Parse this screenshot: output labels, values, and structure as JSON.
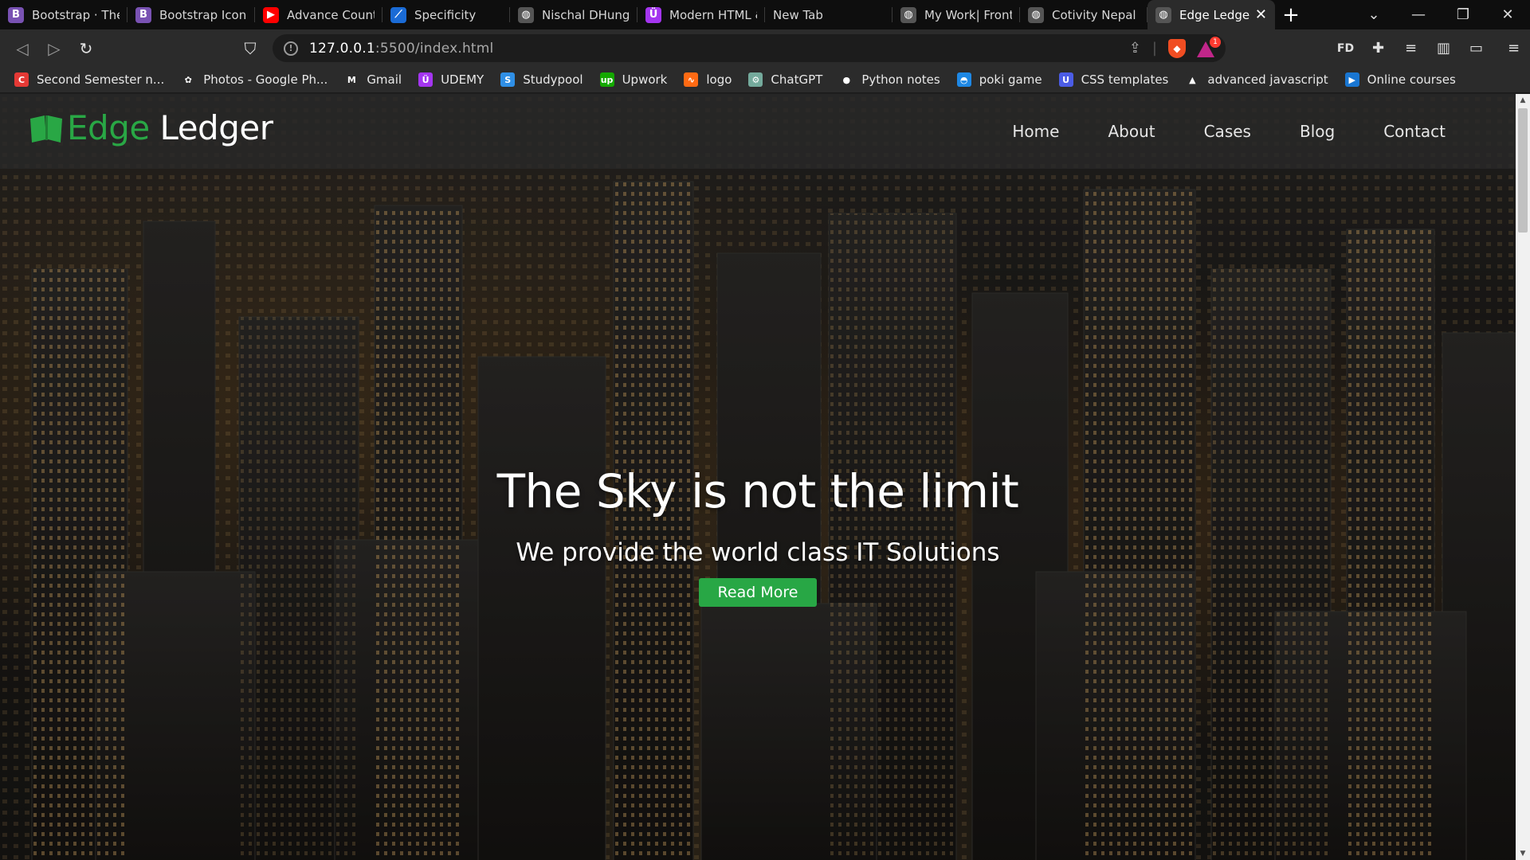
{
  "browser": {
    "tabs": [
      {
        "title": "Bootstrap · The m",
        "icon": "bootstrap-icon",
        "icon_bg": "#7952b3",
        "icon_text": "B"
      },
      {
        "title": "Bootstrap Icons",
        "icon": "bootstrap-icon",
        "icon_bg": "#7952b3",
        "icon_text": "B"
      },
      {
        "title": "Advance Countin",
        "icon": "youtube-icon",
        "icon_bg": "#ff0000",
        "icon_text": "▶"
      },
      {
        "title": "Specificity",
        "icon": "mdn-icon",
        "icon_bg": "#1a6bd6",
        "icon_text": "⟋"
      },
      {
        "title": "Nischal DHunge",
        "icon": "globe-icon",
        "icon_bg": "#555555",
        "icon_text": "◍"
      },
      {
        "title": "Modern HTML &",
        "icon": "udemy-icon",
        "icon_bg": "#a435f0",
        "icon_text": "Ü"
      },
      {
        "title": "New Tab",
        "icon": "",
        "icon_bg": "",
        "icon_text": ""
      },
      {
        "title": "My Work| Front E",
        "icon": "globe-icon",
        "icon_bg": "#555555",
        "icon_text": "◍"
      },
      {
        "title": "Cotivity Nepal Cl",
        "icon": "globe-icon",
        "icon_bg": "#555555",
        "icon_text": "◍"
      },
      {
        "title": "Edge Ledger",
        "icon": "globe-icon",
        "icon_bg": "#555555",
        "icon_text": "◍",
        "active": true
      }
    ],
    "new_tab_label": "+",
    "address": {
      "host": "127.0.0.1",
      "path": ":5500/index.html"
    },
    "extension_badge": "1",
    "profile_label": "FD",
    "bookmarks": [
      {
        "label": "Second Semester n...",
        "icon": "bookmark-c-icon",
        "icon_bg": "#e53935",
        "icon_text": "C"
      },
      {
        "label": "Photos - Google Ph...",
        "icon": "google-photos-icon",
        "icon_bg": "#2b2b2b",
        "icon_text": "✿"
      },
      {
        "label": "Gmail",
        "icon": "gmail-icon",
        "icon_bg": "#2b2b2b",
        "icon_text": "M"
      },
      {
        "label": "UDEMY",
        "icon": "udemy-icon",
        "icon_bg": "#a435f0",
        "icon_text": "Ü"
      },
      {
        "label": "Studypool",
        "icon": "studypool-icon",
        "icon_bg": "#2f8fe6",
        "icon_text": "S"
      },
      {
        "label": "Upwork",
        "icon": "upwork-icon",
        "icon_bg": "#14a800",
        "icon_text": "up"
      },
      {
        "label": "logo",
        "icon": "logo-maker-icon",
        "icon_bg": "#ff6a13",
        "icon_text": "∿"
      },
      {
        "label": "ChatGPT",
        "icon": "chatgpt-icon",
        "icon_bg": "#74aa9c",
        "icon_text": "⚙"
      },
      {
        "label": "Python notes",
        "icon": "github-icon",
        "icon_bg": "#2b2b2b",
        "icon_text": "●"
      },
      {
        "label": "poki game",
        "icon": "poki-icon",
        "icon_bg": "#1e88e5",
        "icon_text": "◓"
      },
      {
        "label": "CSS templates",
        "icon": "css-templates-icon",
        "icon_bg": "#4b5ce6",
        "icon_text": "U"
      },
      {
        "label": "advanced javascript",
        "icon": "js-folder-icon",
        "icon_bg": "#2b2b2b",
        "icon_text": "▲"
      },
      {
        "label": "Online courses",
        "icon": "courses-icon",
        "icon_bg": "#1976d2",
        "icon_text": "▶"
      }
    ]
  },
  "site": {
    "logo": {
      "part1": "Edge",
      "part2": " Ledger"
    },
    "nav": [
      "Home",
      "About",
      "Cases",
      "Blog",
      "Contact"
    ],
    "hero": {
      "title": "The Sky is not the limit",
      "subtitle": "We provide the world class IT Solutions",
      "cta": "Read More"
    },
    "colors": {
      "accent": "#28a745",
      "navbar": "#282828"
    }
  }
}
